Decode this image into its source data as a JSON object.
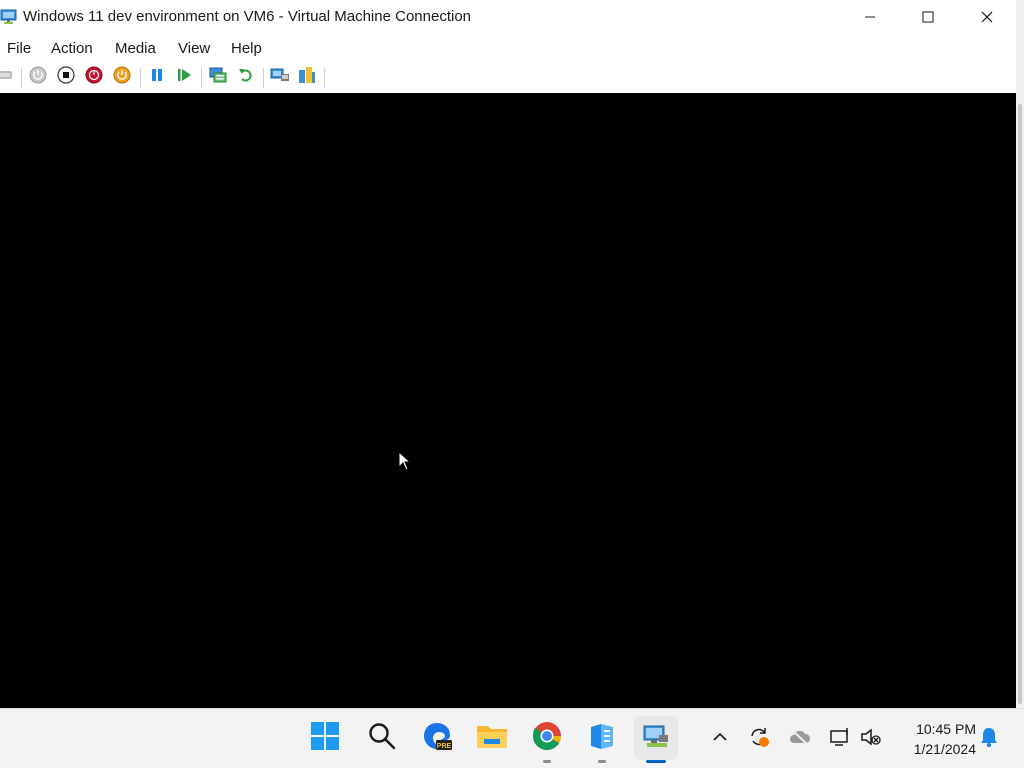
{
  "window": {
    "title": "Windows 11 dev environment on VM6 - Virtual Machine Connection"
  },
  "menu": {
    "items": [
      "File",
      "Action",
      "Media",
      "View",
      "Help"
    ]
  },
  "toolbar": {
    "buttons": [
      {
        "name": "ctrl-alt-del-icon"
      },
      {
        "name": "start-icon"
      },
      {
        "name": "turn-off-icon"
      },
      {
        "name": "shut-down-icon"
      },
      {
        "name": "save-icon"
      },
      {
        "name": "pause-icon"
      },
      {
        "name": "resume-icon"
      },
      {
        "name": "checkpoint-icon"
      },
      {
        "name": "revert-icon"
      },
      {
        "name": "enhanced-session-icon"
      },
      {
        "name": "share-icon"
      }
    ]
  },
  "taskbar": {
    "apps": [
      {
        "name": "start-icon"
      },
      {
        "name": "search-icon"
      },
      {
        "name": "edge-preview-icon",
        "badge": "PRE"
      },
      {
        "name": "file-explorer-icon"
      },
      {
        "name": "chrome-icon"
      },
      {
        "name": "server-manager-icon"
      },
      {
        "name": "hyper-v-vmconnect-icon"
      }
    ],
    "tray": {
      "time": "10:45 PM",
      "date": "1/21/2024"
    }
  },
  "colors": {
    "accent": "#0067c0",
    "vm_background": "#000000"
  }
}
